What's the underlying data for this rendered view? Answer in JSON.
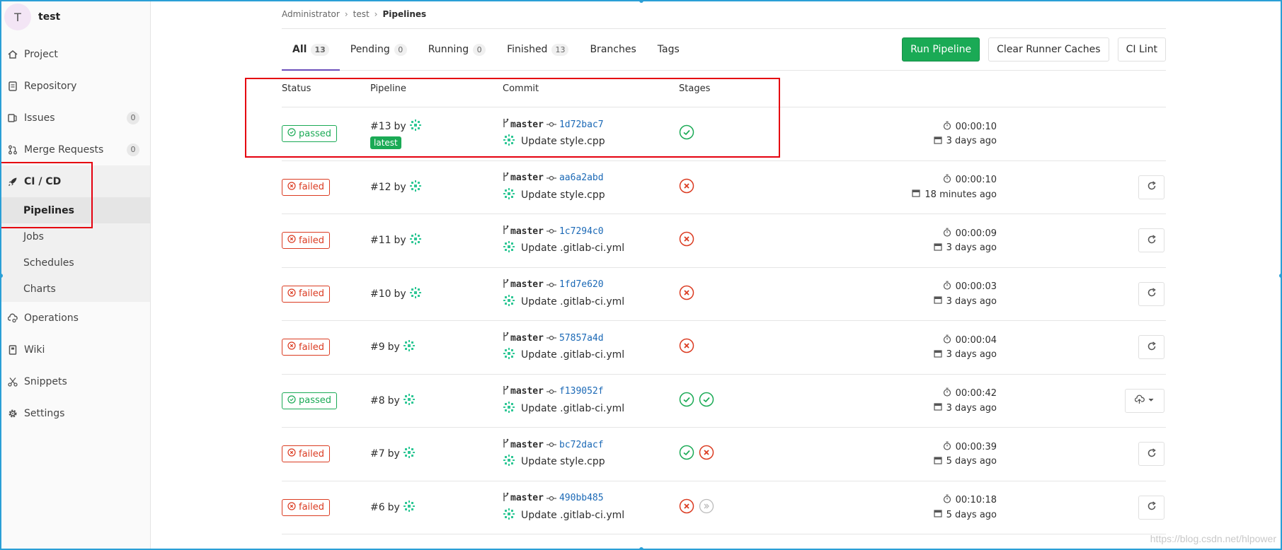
{
  "sidebar": {
    "avatar_letter": "T",
    "project_name": "test",
    "items": [
      {
        "label": "Project",
        "icon": "home-icon"
      },
      {
        "label": "Repository",
        "icon": "doc-icon"
      },
      {
        "label": "Issues",
        "icon": "issues-icon",
        "count": "0"
      },
      {
        "label": "Merge Requests",
        "icon": "merge-icon",
        "count": "0"
      },
      {
        "label": "CI / CD",
        "icon": "rocket-icon"
      },
      {
        "label": "Operations",
        "icon": "cloud-gear-icon"
      },
      {
        "label": "Wiki",
        "icon": "book-icon"
      },
      {
        "label": "Snippets",
        "icon": "scissors-icon"
      },
      {
        "label": "Settings",
        "icon": "gear-icon"
      }
    ],
    "cicd_sub": [
      "Pipelines",
      "Jobs",
      "Schedules",
      "Charts"
    ]
  },
  "breadcrumb": {
    "b1": "Administrator",
    "b2": "test",
    "b3": "Pipelines"
  },
  "tabs": [
    {
      "label": "All",
      "count": "13"
    },
    {
      "label": "Pending",
      "count": "0"
    },
    {
      "label": "Running",
      "count": "0"
    },
    {
      "label": "Finished",
      "count": "13"
    },
    {
      "label": "Branches"
    },
    {
      "label": "Tags"
    }
  ],
  "actions": {
    "run": "Run Pipeline",
    "clear": "Clear Runner Caches",
    "lint": "CI Lint"
  },
  "table": {
    "headers": {
      "status": "Status",
      "pipeline": "Pipeline",
      "commit": "Commit",
      "stages": "Stages"
    },
    "by_label": "by",
    "latest_label": "latest",
    "rows": [
      {
        "status": "passed",
        "id": "#13",
        "latest": true,
        "branch": "master",
        "sha": "1d72bac7",
        "msg": "Update style.cpp",
        "stages": [
          "success"
        ],
        "duration": "00:00:10",
        "finished": "3 days ago",
        "action": "none"
      },
      {
        "status": "failed",
        "id": "#12",
        "branch": "master",
        "sha": "aa6a2abd",
        "msg": "Update style.cpp",
        "stages": [
          "failed"
        ],
        "duration": "00:00:10",
        "finished": "18 minutes ago",
        "action": "retry"
      },
      {
        "status": "failed",
        "id": "#11",
        "branch": "master",
        "sha": "1c7294c0",
        "msg": "Update .gitlab-ci.yml",
        "stages": [
          "failed"
        ],
        "duration": "00:00:09",
        "finished": "3 days ago",
        "action": "retry"
      },
      {
        "status": "failed",
        "id": "#10",
        "branch": "master",
        "sha": "1fd7e620",
        "msg": "Update .gitlab-ci.yml",
        "stages": [
          "failed"
        ],
        "duration": "00:00:03",
        "finished": "3 days ago",
        "action": "retry"
      },
      {
        "status": "failed",
        "id": "#9",
        "branch": "master",
        "sha": "57857a4d",
        "msg": "Update .gitlab-ci.yml",
        "stages": [
          "failed"
        ],
        "duration": "00:00:04",
        "finished": "3 days ago",
        "action": "retry"
      },
      {
        "status": "passed",
        "id": "#8",
        "branch": "master",
        "sha": "f139052f",
        "msg": "Update .gitlab-ci.yml",
        "stages": [
          "success",
          "success"
        ],
        "duration": "00:00:42",
        "finished": "3 days ago",
        "action": "deploy"
      },
      {
        "status": "failed",
        "id": "#7",
        "branch": "master",
        "sha": "bc72dacf",
        "msg": "Update style.cpp",
        "stages": [
          "success",
          "failed"
        ],
        "duration": "00:00:39",
        "finished": "5 days ago",
        "action": "retry"
      },
      {
        "status": "failed",
        "id": "#6",
        "branch": "master",
        "sha": "490bb485",
        "msg": "Update .gitlab-ci.yml",
        "stages": [
          "failed",
          "skipped"
        ],
        "duration": "00:10:18",
        "finished": "5 days ago",
        "action": "retry"
      }
    ]
  },
  "watermark": "https://blog.csdn.net/hlpower",
  "colors": {
    "success": "#1aaa55",
    "failed": "#db3b21",
    "link": "#1b69b6",
    "primary_button": "#1aaa55",
    "annotation": "#e5000f",
    "active_tab": "#6b4fbb"
  }
}
